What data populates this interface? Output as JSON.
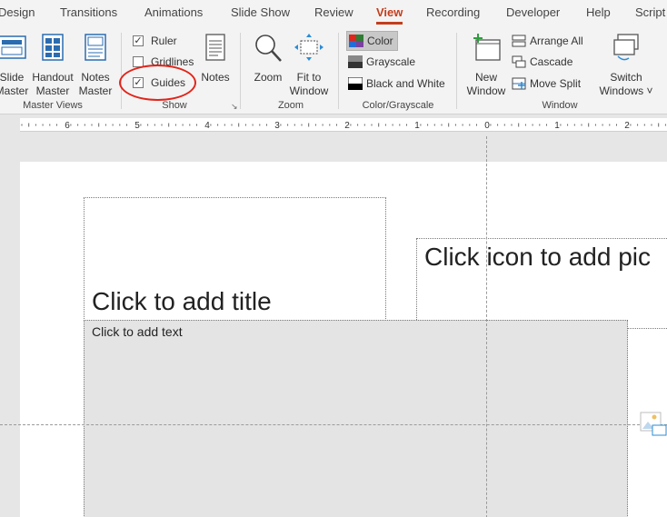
{
  "tabs": [
    "Design",
    "Transitions",
    "Animations",
    "Slide Show",
    "Review",
    "View",
    "Recording",
    "Developer",
    "Help",
    "Script"
  ],
  "active_tab": "View",
  "ribbon": {
    "master_views": {
      "slide_master": "Slide\nMaster",
      "handout_master": "Handout\nMaster",
      "notes_master": "Notes\nMaster",
      "group_label": "Master Views"
    },
    "show": {
      "ruler": "Ruler",
      "gridlines": "Gridlines",
      "guides": "Guides",
      "notes": "Notes",
      "group_label": "Show",
      "ruler_checked": true,
      "gridlines_checked": false,
      "guides_checked": true
    },
    "zoom": {
      "zoom": "Zoom",
      "fit_to_window": "Fit to\nWindow",
      "group_label": "Zoom"
    },
    "color_grayscale": {
      "color": "Color",
      "grayscale": "Grayscale",
      "black_and_white": "Black and White",
      "group_label": "Color/Grayscale"
    },
    "window": {
      "new_window": "New\nWindow",
      "arrange_all": "Arrange All",
      "cascade": "Cascade",
      "move_split": "Move Split",
      "switch_windows": "Switch\nWindows ˅",
      "group_label": "Window"
    }
  },
  "ruler_labels": [
    "6",
    "5",
    "4",
    "3",
    "2",
    "1",
    "0",
    "1",
    "2"
  ],
  "slide": {
    "title_placeholder": "Click to add title",
    "picture_placeholder": "Click icon to add pic",
    "text_placeholder": "Click to add text"
  },
  "colors": {
    "accent": "#c43e1c",
    "annotation_circle": "#e0251b"
  }
}
